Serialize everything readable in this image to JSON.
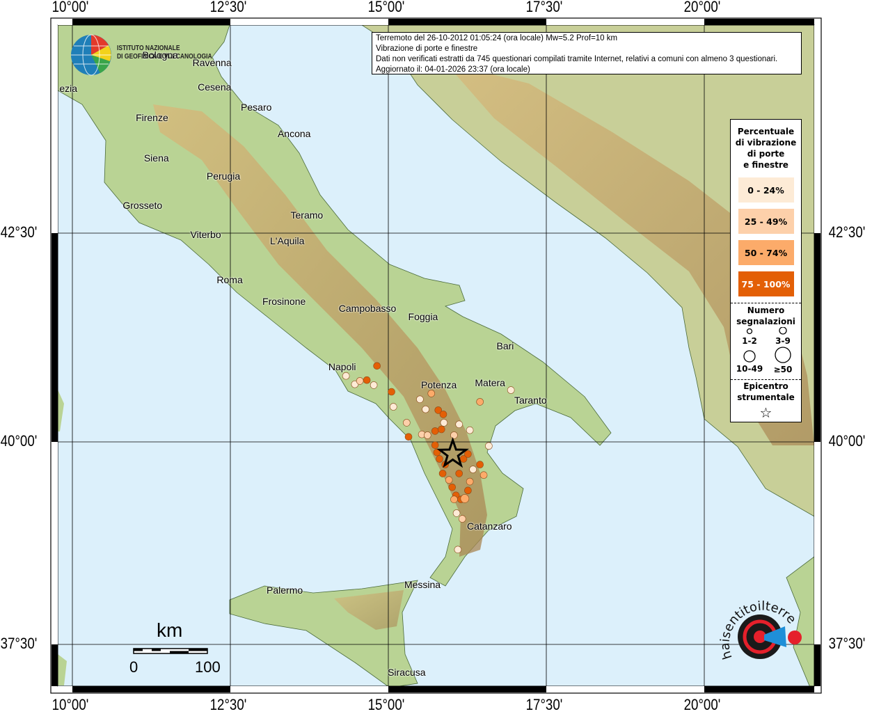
{
  "frame": {
    "lon_labels": [
      "10°00'",
      "12°30'",
      "15°00'",
      "17°30'",
      "20°00'"
    ],
    "lon_values": [
      10,
      12.5,
      15,
      17.5,
      20
    ],
    "lat_labels": [
      "42°30'",
      "40°00'",
      "37°30'"
    ],
    "lat_values": [
      42.5,
      40,
      37.5
    ]
  },
  "logo_ingv": {
    "line1": "ISTITUTO NAZIONALE",
    "line2": "DI GEOFISICA E VULCANOLOGIA"
  },
  "logo_hsit": "www.haisentitoilterremoto.it",
  "title": {
    "line1": "Terremoto del 26-10-2012 01:05:24 (ora locale) Mw=5.2 Prof=10 km",
    "line2": "Vibrazione di porte e finestre",
    "line3": "Dati non verificati estratti da 745 questionari compilati tramite Internet, relativi a comuni con almeno 3 questionari.",
    "line4": "Aggiornato il: 04-01-2026 23:37 (ora locale)"
  },
  "legend": {
    "title": [
      "Percentuale",
      "di vibrazione",
      "di porte",
      "e finestre"
    ],
    "classes": [
      {
        "label": "0 - 24%",
        "color": "#fdebd6",
        "text": "#000"
      },
      {
        "label": "25 - 49%",
        "color": "#fdd0aa",
        "text": "#000"
      },
      {
        "label": "50 - 74%",
        "color": "#fcab6a",
        "text": "#000"
      },
      {
        "label": "75 - 100%",
        "color": "#e35f06",
        "text": "#fff"
      }
    ],
    "count_title": [
      "Numero",
      "segnalazioni"
    ],
    "counts": [
      "1-2",
      "3-9",
      "10-49",
      "≥50"
    ],
    "epicenter_title": [
      "Epicentro",
      "strumentale"
    ]
  },
  "scale": {
    "unit": "km",
    "min": "0",
    "max": "100"
  },
  "epicenter": {
    "lon": 16.02,
    "lat": 39.85
  },
  "cities": [
    {
      "name": "Spezia",
      "lon": 9.96,
      "lat": 44.23
    },
    {
      "name": "Bologna",
      "lon": 11.39,
      "lat": 44.63
    },
    {
      "name": "Ravenna",
      "lon": 12.21,
      "lat": 44.54
    },
    {
      "name": "Cesena",
      "lon": 12.25,
      "lat": 44.25
    },
    {
      "name": "Pesaro",
      "lon": 12.91,
      "lat": 44.01
    },
    {
      "name": "Ancona",
      "lon": 13.51,
      "lat": 43.69
    },
    {
      "name": "Firenze",
      "lon": 11.26,
      "lat": 43.88
    },
    {
      "name": "Siena",
      "lon": 11.33,
      "lat": 43.4
    },
    {
      "name": "Perugia",
      "lon": 12.39,
      "lat": 43.18
    },
    {
      "name": "Grosseto",
      "lon": 11.11,
      "lat": 42.83
    },
    {
      "name": "Teramo",
      "lon": 13.71,
      "lat": 42.72
    },
    {
      "name": "Viterbo",
      "lon": 12.11,
      "lat": 42.48
    },
    {
      "name": "L'Aquila",
      "lon": 13.4,
      "lat": 42.41
    },
    {
      "name": "Roma",
      "lon": 12.49,
      "lat": 41.94
    },
    {
      "name": "Frosinone",
      "lon": 13.35,
      "lat": 41.68
    },
    {
      "name": "Campobasso",
      "lon": 14.67,
      "lat": 41.6
    },
    {
      "name": "Foggia",
      "lon": 15.55,
      "lat": 41.5
    },
    {
      "name": "Bari",
      "lon": 16.85,
      "lat": 41.15
    },
    {
      "name": "Napoli",
      "lon": 14.27,
      "lat": 40.9
    },
    {
      "name": "Potenza",
      "lon": 15.8,
      "lat": 40.68
    },
    {
      "name": "Matera",
      "lon": 16.61,
      "lat": 40.71
    },
    {
      "name": "Taranto",
      "lon": 17.25,
      "lat": 40.5
    },
    {
      "name": "Catanzaro",
      "lon": 16.6,
      "lat": 38.96
    },
    {
      "name": "Messina",
      "lon": 15.54,
      "lat": 38.24
    },
    {
      "name": "Palermo",
      "lon": 13.36,
      "lat": 38.17
    },
    {
      "name": "Siracusa",
      "lon": 15.29,
      "lat": 37.16
    }
  ],
  "observations": [
    {
      "lon": 14.33,
      "lat": 40.79,
      "cls": 0,
      "n": 1
    },
    {
      "lon": 14.47,
      "lat": 40.69,
      "cls": 0,
      "n": 1
    },
    {
      "lon": 14.55,
      "lat": 40.73,
      "cls": 1,
      "n": 2
    },
    {
      "lon": 14.66,
      "lat": 40.74,
      "cls": 3,
      "n": 2
    },
    {
      "lon": 14.77,
      "lat": 40.68,
      "cls": 0,
      "n": 2
    },
    {
      "lon": 14.82,
      "lat": 40.91,
      "cls": 3,
      "n": 1
    },
    {
      "lon": 15.05,
      "lat": 40.6,
      "cls": 3,
      "n": 1
    },
    {
      "lon": 15.08,
      "lat": 40.42,
      "cls": 0,
      "n": 1
    },
    {
      "lon": 15.29,
      "lat": 40.23,
      "cls": 1,
      "n": 1
    },
    {
      "lon": 15.32,
      "lat": 40.06,
      "cls": 3,
      "n": 1
    },
    {
      "lon": 15.5,
      "lat": 40.51,
      "cls": 0,
      "n": 1
    },
    {
      "lon": 15.59,
      "lat": 40.39,
      "cls": 0,
      "n": 1
    },
    {
      "lon": 15.68,
      "lat": 40.58,
      "cls": 2,
      "n": 1
    },
    {
      "lon": 15.79,
      "lat": 40.38,
      "cls": 3,
      "n": 1
    },
    {
      "lon": 15.87,
      "lat": 40.33,
      "cls": 3,
      "n": 1
    },
    {
      "lon": 15.88,
      "lat": 40.23,
      "cls": 0,
      "n": 1
    },
    {
      "lon": 15.53,
      "lat": 40.09,
      "cls": 1,
      "n": 1
    },
    {
      "lon": 15.62,
      "lat": 40.08,
      "cls": 1,
      "n": 1
    },
    {
      "lon": 15.74,
      "lat": 40.13,
      "cls": 3,
      "n": 1
    },
    {
      "lon": 15.84,
      "lat": 40.15,
      "cls": 3,
      "n": 1
    },
    {
      "lon": 16.04,
      "lat": 40.08,
      "cls": 1,
      "n": 1
    },
    {
      "lon": 16.12,
      "lat": 40.21,
      "cls": 0,
      "n": 1
    },
    {
      "lon": 16.29,
      "lat": 40.14,
      "cls": 0,
      "n": 1
    },
    {
      "lon": 16.45,
      "lat": 40.48,
      "cls": 2,
      "n": 1
    },
    {
      "lon": 16.59,
      "lat": 39.95,
      "cls": 0,
      "n": 1
    },
    {
      "lon": 16.94,
      "lat": 40.62,
      "cls": 0,
      "n": 1
    },
    {
      "lon": 15.74,
      "lat": 39.96,
      "cls": 3,
      "n": 2
    },
    {
      "lon": 15.77,
      "lat": 39.87,
      "cls": 3,
      "n": 2
    },
    {
      "lon": 15.81,
      "lat": 39.79,
      "cls": 3,
      "n": 2
    },
    {
      "lon": 15.9,
      "lat": 39.72,
      "cls": 3,
      "n": 1
    },
    {
      "lon": 15.86,
      "lat": 39.61,
      "cls": 3,
      "n": 2
    },
    {
      "lon": 15.96,
      "lat": 39.53,
      "cls": 2,
      "n": 1
    },
    {
      "lon": 16.01,
      "lat": 39.44,
      "cls": 3,
      "n": 1
    },
    {
      "lon": 16.07,
      "lat": 39.34,
      "cls": 3,
      "n": 1
    },
    {
      "lon": 16.15,
      "lat": 39.29,
      "cls": 3,
      "n": 2
    },
    {
      "lon": 16.21,
      "lat": 39.3,
      "cls": 2,
      "n": 3
    },
    {
      "lon": 16.26,
      "lat": 39.4,
      "cls": 3,
      "n": 1
    },
    {
      "lon": 16.29,
      "lat": 39.51,
      "cls": 2,
      "n": 1
    },
    {
      "lon": 16.34,
      "lat": 39.66,
      "cls": 0,
      "n": 1
    },
    {
      "lon": 16.45,
      "lat": 39.72,
      "cls": 3,
      "n": 2
    },
    {
      "lon": 16.51,
      "lat": 39.59,
      "cls": 2,
      "n": 2
    },
    {
      "lon": 16.19,
      "lat": 39.79,
      "cls": 3,
      "n": 2
    },
    {
      "lon": 16.12,
      "lat": 39.61,
      "cls": 3,
      "n": 1
    },
    {
      "lon": 16.04,
      "lat": 39.29,
      "cls": 2,
      "n": 1
    },
    {
      "lon": 16.08,
      "lat": 39.12,
      "cls": 0,
      "n": 1
    },
    {
      "lon": 16.1,
      "lat": 38.67,
      "cls": 0,
      "n": 1
    },
    {
      "lon": 16.17,
      "lat": 39.05,
      "cls": 1,
      "n": 1
    },
    {
      "lon": 16.26,
      "lat": 39.85,
      "cls": 3,
      "n": 2
    }
  ],
  "colors": {
    "sea": "#dcf0fb",
    "land": "#b9d394",
    "mountain": "#c9a56a",
    "grid": "#000000"
  }
}
